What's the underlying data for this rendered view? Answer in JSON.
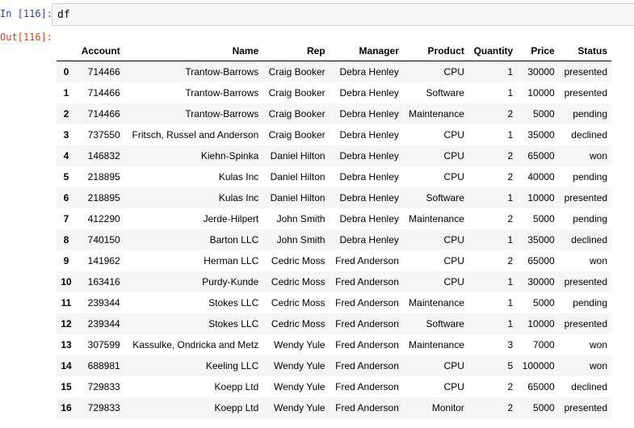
{
  "cell": {
    "in_prompt": "In [116]:",
    "out_prompt": "Out[116]:",
    "code": "df"
  },
  "table": {
    "columns": [
      "",
      "Account",
      "Name",
      "Rep",
      "Manager",
      "Product",
      "Quantity",
      "Price",
      "Status"
    ],
    "rows": [
      [
        "0",
        "714466",
        "Trantow-Barrows",
        "Craig Booker",
        "Debra Henley",
        "CPU",
        "1",
        "30000",
        "presented"
      ],
      [
        "1",
        "714466",
        "Trantow-Barrows",
        "Craig Booker",
        "Debra Henley",
        "Software",
        "1",
        "10000",
        "presented"
      ],
      [
        "2",
        "714466",
        "Trantow-Barrows",
        "Craig Booker",
        "Debra Henley",
        "Maintenance",
        "2",
        "5000",
        "pending"
      ],
      [
        "3",
        "737550",
        "Fritsch, Russel and Anderson",
        "Craig Booker",
        "Debra Henley",
        "CPU",
        "1",
        "35000",
        "declined"
      ],
      [
        "4",
        "146832",
        "Kiehn-Spinka",
        "Daniel Hilton",
        "Debra Henley",
        "CPU",
        "2",
        "65000",
        "won"
      ],
      [
        "5",
        "218895",
        "Kulas Inc",
        "Daniel Hilton",
        "Debra Henley",
        "CPU",
        "2",
        "40000",
        "pending"
      ],
      [
        "6",
        "218895",
        "Kulas Inc",
        "Daniel Hilton",
        "Debra Henley",
        "Software",
        "1",
        "10000",
        "presented"
      ],
      [
        "7",
        "412290",
        "Jerde-Hilpert",
        "John Smith",
        "Debra Henley",
        "Maintenance",
        "2",
        "5000",
        "pending"
      ],
      [
        "8",
        "740150",
        "Barton LLC",
        "John Smith",
        "Debra Henley",
        "CPU",
        "1",
        "35000",
        "declined"
      ],
      [
        "9",
        "141962",
        "Herman LLC",
        "Cedric Moss",
        "Fred Anderson",
        "CPU",
        "2",
        "65000",
        "won"
      ],
      [
        "10",
        "163416",
        "Purdy-Kunde",
        "Cedric Moss",
        "Fred Anderson",
        "CPU",
        "1",
        "30000",
        "presented"
      ],
      [
        "11",
        "239344",
        "Stokes LLC",
        "Cedric Moss",
        "Fred Anderson",
        "Maintenance",
        "1",
        "5000",
        "pending"
      ],
      [
        "12",
        "239344",
        "Stokes LLC",
        "Cedric Moss",
        "Fred Anderson",
        "Software",
        "1",
        "10000",
        "presented"
      ],
      [
        "13",
        "307599",
        "Kassulke, Ondricka and Metz",
        "Wendy Yule",
        "Fred Anderson",
        "Maintenance",
        "3",
        "7000",
        "won"
      ],
      [
        "14",
        "688981",
        "Keeling LLC",
        "Wendy Yule",
        "Fred Anderson",
        "CPU",
        "5",
        "100000",
        "won"
      ],
      [
        "15",
        "729833",
        "Koepp Ltd",
        "Wendy Yule",
        "Fred Anderson",
        "CPU",
        "2",
        "65000",
        "declined"
      ],
      [
        "16",
        "729833",
        "Koepp Ltd",
        "Wendy Yule",
        "Fred Anderson",
        "Monitor",
        "2",
        "5000",
        "presented"
      ]
    ]
  },
  "colors": {
    "in_prompt": "#303f9f",
    "out_prompt": "#d84315",
    "input_bg": "#f7f7f7",
    "stripe": "#f5f5f5"
  }
}
